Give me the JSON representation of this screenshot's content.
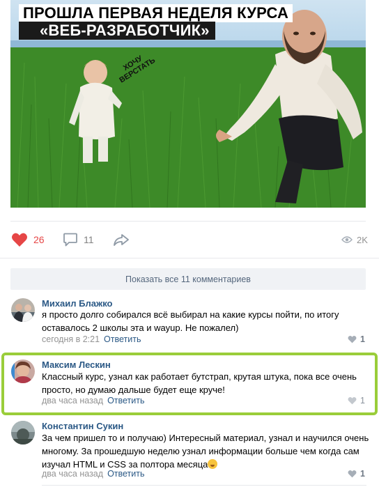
{
  "post": {
    "meme_title_line1": "ПРОШЛА ПЕРВАЯ НЕДЕЛЯ КУРСА",
    "meme_title_line2": "«ВЕБ-РАЗРАБОТЧИК»",
    "meme_caption_line1": "ХОЧУ",
    "meme_caption_line2": "ВЕРСТАТЬ"
  },
  "actions": {
    "likes": "26",
    "comments": "11",
    "views": "2K",
    "like_color": "#e64646"
  },
  "comments_block": {
    "show_all_label": "Показать все 11 комментариев",
    "reply_label": "Ответить",
    "items": [
      {
        "author": "Михаил Блажко",
        "text": "я просто долго собирался всё выбирал на какие курсы пойти, по итогу оставалось 2 школы эта и wayup. Не пожалел)",
        "time": "сегодня в 2:21",
        "likes": "1"
      },
      {
        "author": "Максим Лескин",
        "text": "Классный курс, узнал как работает бутстрап, крутая штука, пока все очень просто, но думаю дальше будет еще круче!",
        "time": "два часа назад",
        "likes": "1"
      },
      {
        "author": "Константин Сукин",
        "text": "За чем пришел то и получаю) Интересный материал, узнал и научился очень многому. За прошедшую неделю узнал информации больше чем когда сам изучал HTML и CSS за полтора месяца",
        "time": "два часа назад",
        "likes": "1"
      }
    ]
  },
  "colors": {
    "link": "#2a5885",
    "highlight_border": "#9acd3a",
    "show_all_bg": "#f0f2f5"
  }
}
